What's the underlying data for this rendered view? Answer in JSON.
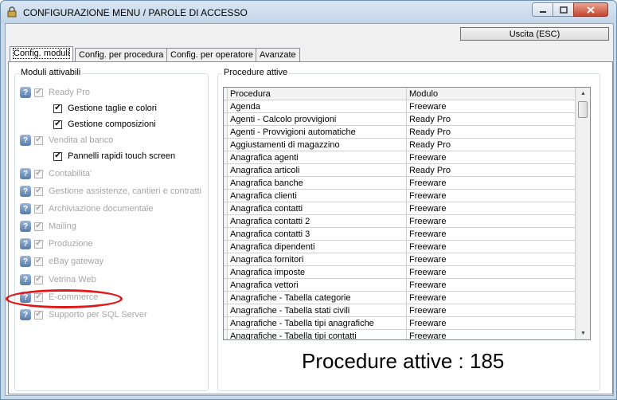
{
  "window": {
    "title": "CONFIGURAZIONE MENU / PAROLE DI ACCESSO"
  },
  "toolbar": {
    "exit_label": "Uscita (ESC)"
  },
  "tabs": [
    {
      "label": "Config. moduli"
    },
    {
      "label": "Config. per procedura"
    },
    {
      "label": "Config. per operatore"
    },
    {
      "label": "Avanzate"
    }
  ],
  "modules": {
    "title": "Moduli attivabili",
    "items": [
      {
        "label": "Ready Pro"
      },
      {
        "label": "Gestione taglie e colori"
      },
      {
        "label": "Gestione composizioni"
      },
      {
        "label": "Vendita al banco"
      },
      {
        "label": "Pannelli rapidi touch screen"
      },
      {
        "label": "Contabilita'"
      },
      {
        "label": "Gestione assistenze, cantieri e contratti"
      },
      {
        "label": "Archiviazione documentale"
      },
      {
        "label": "Mailing"
      },
      {
        "label": "Produzione"
      },
      {
        "label": "eBay gateway"
      },
      {
        "label": "Vetrina Web"
      },
      {
        "label": "E-commerce"
      },
      {
        "label": "Supporto per SQL Server"
      }
    ]
  },
  "procedures": {
    "title": "Procedure attive",
    "columns": [
      "Procedura",
      "Modulo"
    ],
    "rows": [
      [
        "Agenda",
        "Freeware"
      ],
      [
        "Agenti - Calcolo provvigioni",
        "Ready Pro"
      ],
      [
        "Agenti - Provvigioni automatiche",
        "Ready Pro"
      ],
      [
        "Aggiustamenti di magazzino",
        "Ready Pro"
      ],
      [
        "Anagrafica agenti",
        "Freeware"
      ],
      [
        "Anagrafica articoli",
        "Ready Pro"
      ],
      [
        "Anagrafica banche",
        "Freeware"
      ],
      [
        "Anagrafica clienti",
        "Freeware"
      ],
      [
        "Anagrafica contatti",
        "Freeware"
      ],
      [
        "Anagrafica contatti 2",
        "Freeware"
      ],
      [
        "Anagrafica contatti 3",
        "Freeware"
      ],
      [
        "Anagrafica dipendenti",
        "Freeware"
      ],
      [
        "Anagrafica fornitori",
        "Freeware"
      ],
      [
        "Anagrafica imposte",
        "Freeware"
      ],
      [
        "Anagrafica vettori",
        "Freeware"
      ],
      [
        "Anagrafiche - Tabella categorie",
        "Freeware"
      ],
      [
        "Anagrafiche - Tabella stati civili",
        "Freeware"
      ],
      [
        "Anagrafiche - Tabella tipi anagrafiche",
        "Freeware"
      ],
      [
        "Anagrafiche - Tabella tipi contatti",
        "Freeware"
      ]
    ],
    "count_label": "Procedure attive : 185"
  },
  "colors": {
    "highlight": "#e01818",
    "disabled_text": "#a6a6a6"
  }
}
